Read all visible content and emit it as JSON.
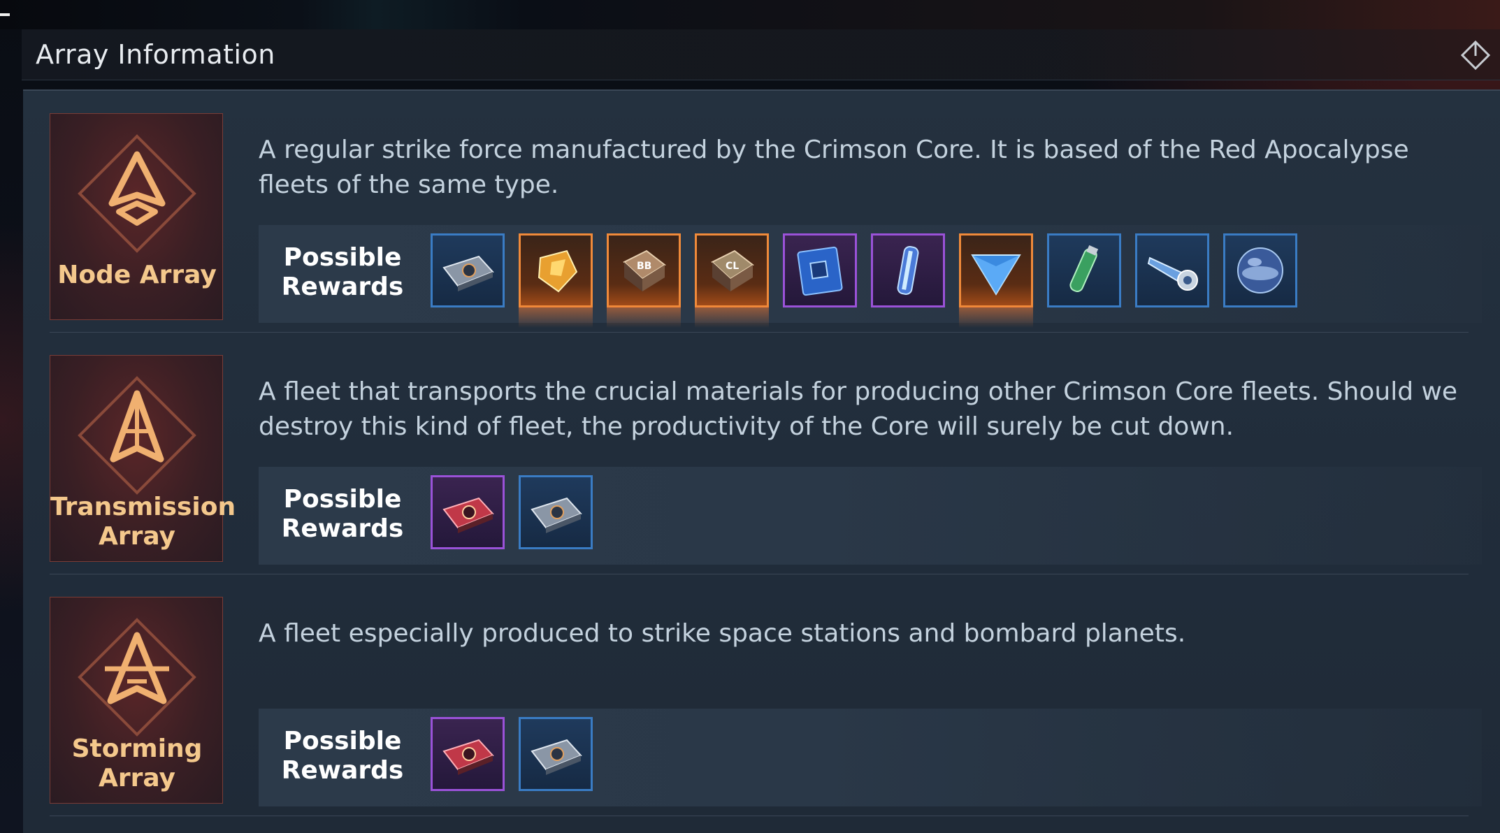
{
  "header": {
    "title": "Array Information"
  },
  "arrays": [
    {
      "name": "Node Array",
      "description": "A regular strike force manufactured by the Crimson Core. It is based of the Red Apocalypse fleets of the same type.",
      "rewards_label": "Possible Rewards",
      "rewards": [
        {
          "icon": "blueprint-chip-icon",
          "rarity": "blue"
        },
        {
          "icon": "gold-crystal-icon",
          "rarity": "orange"
        },
        {
          "icon": "bb-module-icon",
          "rarity": "orange"
        },
        {
          "icon": "cl-module-icon",
          "rarity": "orange"
        },
        {
          "icon": "blue-circuit-card-icon",
          "rarity": "purple"
        },
        {
          "icon": "energy-capsule-icon",
          "rarity": "purple"
        },
        {
          "icon": "blue-prism-icon",
          "rarity": "orange"
        },
        {
          "icon": "green-vial-icon",
          "rarity": "blue"
        },
        {
          "icon": "ion-cannon-icon",
          "rarity": "blue"
        },
        {
          "icon": "planet-sphere-icon",
          "rarity": "blue"
        }
      ]
    },
    {
      "name": "Transmission Array",
      "description": "A fleet that transports the crucial materials for producing other Crimson Core fleets. Should we destroy this kind of fleet, the productivity of the Core will surely be cut down.",
      "rewards_label": "Possible Rewards",
      "rewards": [
        {
          "icon": "red-blueprint-chip-icon",
          "rarity": "purple"
        },
        {
          "icon": "blueprint-chip-icon",
          "rarity": "blue"
        }
      ]
    },
    {
      "name": "Storming Array",
      "description": "A fleet especially produced to strike space stations and bombard planets.",
      "rewards_label": "Possible Rewards",
      "rewards": [
        {
          "icon": "red-blueprint-chip-icon",
          "rarity": "purple"
        },
        {
          "icon": "blueprint-chip-icon",
          "rarity": "blue"
        }
      ]
    }
  ],
  "colors": {
    "blue": "#3a7cc4",
    "purple": "#9a52d8",
    "orange": "#f08a3a",
    "badge_text": "#f4c88c"
  }
}
